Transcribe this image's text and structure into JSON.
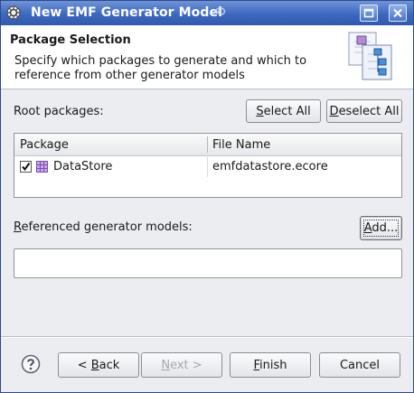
{
  "window": {
    "title": "New EMF Generator Model",
    "title_bar_color": "#3e68bf"
  },
  "header": {
    "title": "Package Selection",
    "description": "Specify which packages to generate and which to reference from other generator models"
  },
  "root_packages": {
    "label": "Root packages:",
    "select_all": {
      "mnemonic": "S",
      "rest": "elect All"
    },
    "deselect_all": {
      "mnemonic": "D",
      "rest": "eselect All"
    },
    "columns": [
      "Package",
      "File Name"
    ],
    "rows": [
      {
        "package": "DataStore",
        "file": "emfdatastore.ecore",
        "checked": true,
        "icon": "epackage-icon"
      }
    ]
  },
  "referenced": {
    "label_mnemonic": "R",
    "label_rest": "eferenced generator models:",
    "add": {
      "mnemonic": "A",
      "rest": "dd..."
    }
  },
  "footer": {
    "back": {
      "prefix": "< ",
      "mnemonic": "B",
      "rest": "ack"
    },
    "next": {
      "mnemonic": "N",
      "rest": "ext >"
    },
    "finish": {
      "mnemonic": "F",
      "rest": "inish"
    },
    "cancel": "Cancel",
    "help_icon": "help-icon"
  }
}
